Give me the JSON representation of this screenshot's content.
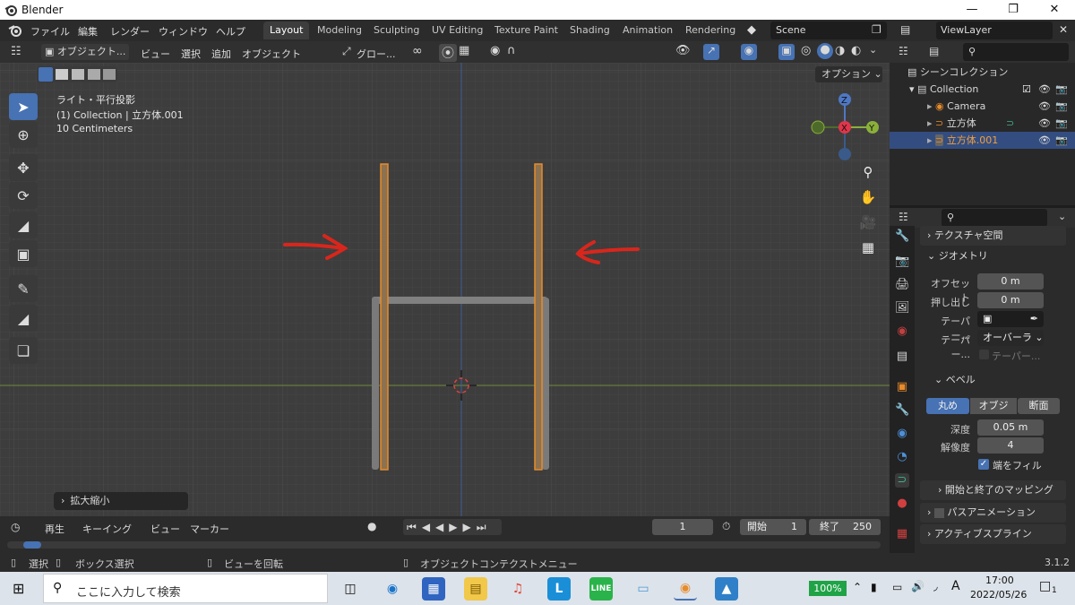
{
  "window": {
    "title": "Blender"
  },
  "menu": [
    "ファイル",
    "編集",
    "レンダー",
    "ウィンドウ",
    "ヘルプ"
  ],
  "workspaces": [
    "Layout",
    "Modeling",
    "Sculpting",
    "UV Editing",
    "Texture Paint",
    "Shading",
    "Animation",
    "Rendering"
  ],
  "scene": "Scene",
  "view_layer": "ViewLayer",
  "viewport_header": {
    "mode": "オブジェクト...",
    "items": [
      "ビュー",
      "選択",
      "追加",
      "オブジェクト"
    ],
    "transform": "グロー...",
    "options": "オプション"
  },
  "overlay_text": {
    "view": "ライト・平行投影",
    "collection": "(1) Collection | 立方体.001",
    "scale": "10 Centimeters"
  },
  "last_op": "拡大縮小",
  "gizmo": {
    "z": "Z",
    "x": "X",
    "y": "Y"
  },
  "outliner": {
    "root": "シーンコレクション",
    "items": [
      "Collection",
      "Camera",
      "立方体",
      "立方体.001"
    ]
  },
  "properties": {
    "texture_space": "テクスチャ空間",
    "geometry": "ジオメトリ",
    "offset_label": "オフセット",
    "offset": "0 m",
    "extrude_label": "押し出し",
    "extrude": "0 m",
    "taper_label": "テーパー...",
    "taper2_label": "テーパー...",
    "taper2": "オーバーラ",
    "taper3": "テーパー...",
    "bevel": "ベベル",
    "bevel_tabs": [
      "丸め",
      "オブジェ...",
      "断面"
    ],
    "depth_label": "深度",
    "depth": "0.05 m",
    "resolution_label": "解像度",
    "resolution": "4",
    "fill_caps": "端をフィル",
    "start_end": "開始と終了のマッピング",
    "path_anim": "パスアニメーション",
    "active_spline": "アクティブスプライン"
  },
  "timeline": {
    "items": [
      "再生",
      "キーイング",
      "ビュー",
      "マーカー"
    ],
    "current": "1",
    "start_label": "開始",
    "start": "1",
    "end_label": "終了",
    "end": "250"
  },
  "status": {
    "select": "選択",
    "box": "ボックス選択",
    "rotate": "ビューを回転",
    "context": "オブジェクトコンテクストメニュー",
    "version": "3.1.2"
  },
  "taskbar": {
    "search": "ここに入力して検索",
    "battery": "100%",
    "time": "17:00",
    "date": "2022/05/26",
    "notif": "1"
  },
  "colors": {
    "accent": "#4772b3",
    "orange": "#e88b2a",
    "red_arrow": "#d9261c"
  }
}
